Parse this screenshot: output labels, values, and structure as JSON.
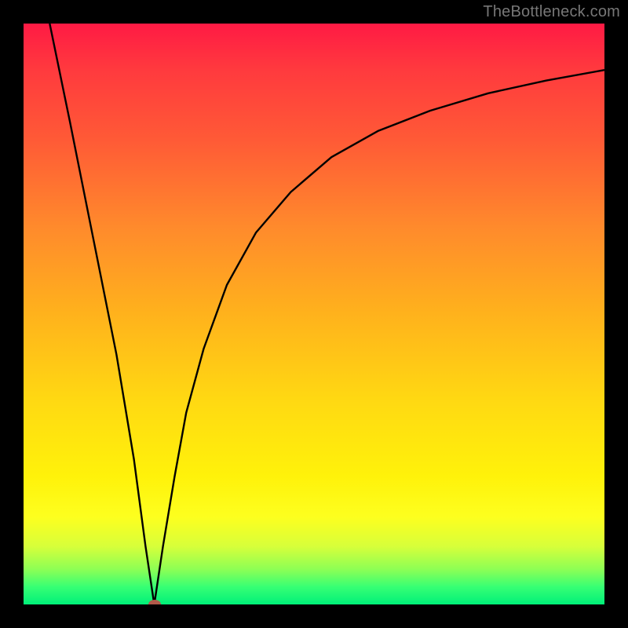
{
  "watermark": "TheBottleneck.com",
  "chart_data": {
    "type": "line",
    "title": "",
    "xlabel": "",
    "ylabel": "",
    "xlim": [
      0,
      100
    ],
    "ylim": [
      0,
      100
    ],
    "grid": false,
    "legend": null,
    "background_gradient_stops": [
      {
        "pos": 0,
        "color": "#ff1a44"
      },
      {
        "pos": 8,
        "color": "#ff3a3e"
      },
      {
        "pos": 20,
        "color": "#ff5a36"
      },
      {
        "pos": 35,
        "color": "#ff8a2c"
      },
      {
        "pos": 50,
        "color": "#ffb21c"
      },
      {
        "pos": 65,
        "color": "#ffd912"
      },
      {
        "pos": 78,
        "color": "#fff20a"
      },
      {
        "pos": 85,
        "color": "#fdff1f"
      },
      {
        "pos": 90,
        "color": "#d7ff3a"
      },
      {
        "pos": 94,
        "color": "#8cff55"
      },
      {
        "pos": 97,
        "color": "#36ff74"
      },
      {
        "pos": 100,
        "color": "#00f079"
      }
    ],
    "series": [
      {
        "name": "bottleneck-left",
        "x": [
          4.5,
          8,
          12,
          16,
          19,
          21,
          22.5
        ],
        "y": [
          100,
          83,
          63,
          43,
          25,
          10,
          0
        ]
      },
      {
        "name": "bottleneck-right",
        "x": [
          22.5,
          24,
          26,
          28,
          31,
          35,
          40,
          46,
          53,
          61,
          70,
          80,
          90,
          100
        ],
        "y": [
          0,
          10,
          22,
          33,
          44,
          55,
          64,
          71,
          77,
          81.5,
          85,
          88,
          90.2,
          92
        ]
      }
    ],
    "marker": {
      "x": 22.5,
      "y": 0,
      "color": "#b15a4a"
    }
  }
}
